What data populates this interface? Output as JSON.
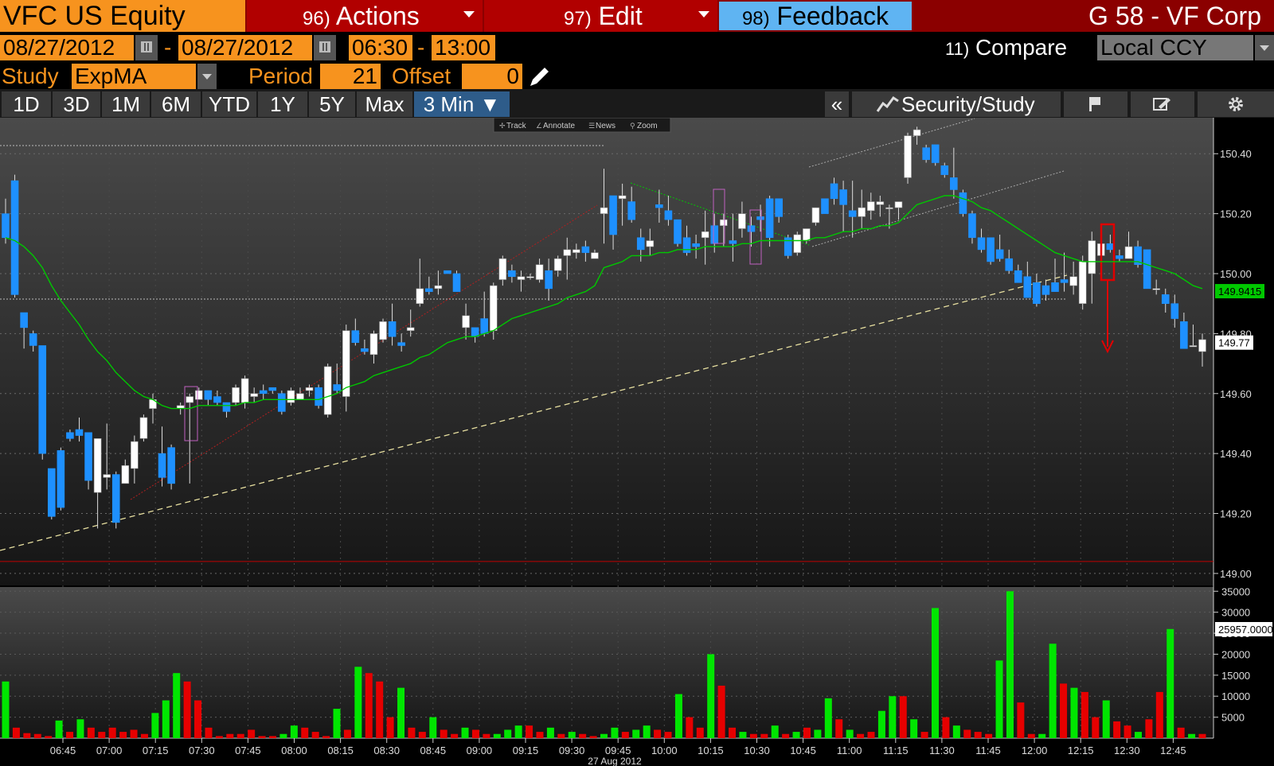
{
  "header": {
    "ticker": "VFC US Equity",
    "actions_num": "96)",
    "actions": "Actions",
    "edit_num": "97)",
    "edit": "Edit",
    "feedback_num": "98)",
    "feedback": "Feedback",
    "title": "G 58 - VF Corp"
  },
  "controls": {
    "start_date": "08/27/2012",
    "dash": "-",
    "end_date": "08/27/2012",
    "start_time": "06:30",
    "end_time": "13:00",
    "compare_num": "11)",
    "compare": "Compare",
    "currency": "Local CCY",
    "study_label": "Study",
    "study": "ExpMA",
    "period_label": "Period",
    "period": "21",
    "offset_label": "Offset",
    "offset": "0"
  },
  "tabs": [
    "1D",
    "3D",
    "1M",
    "6M",
    "YTD",
    "1Y",
    "5Y",
    "Max",
    "3 Min ▼"
  ],
  "right_tabs": {
    "collapse": "«",
    "security_study": "Security/Study"
  },
  "toolbar": [
    "Track",
    "Annotate",
    "News",
    "Zoom"
  ],
  "colors": {
    "up_volume": "#00e600",
    "down_volume": "#e60000",
    "candle_down": "#1e90ff",
    "ema": "#00c800",
    "orange": "#f7931e"
  },
  "chart_data": {
    "type": "candlestick",
    "date_label": "27 Aug 2012",
    "time_labels": [
      "06:45",
      "07:00",
      "07:15",
      "07:30",
      "07:45",
      "08:00",
      "08:15",
      "08:30",
      "08:45",
      "09:00",
      "09:15",
      "09:30",
      "09:45",
      "10:00",
      "10:15",
      "10:30",
      "10:45",
      "11:00",
      "11:15",
      "11:30",
      "11:45",
      "12:00",
      "12:15",
      "12:30",
      "12:45"
    ],
    "price_ticks": [
      "150.40",
      "150.20",
      "150.00",
      "149.80",
      "149.60",
      "149.40",
      "149.20",
      "149.00"
    ],
    "price_ylim": [
      148.96,
      150.52
    ],
    "volume_ticks": [
      "35000",
      "30000",
      "25000",
      "20000",
      "15000",
      "10000",
      "5000"
    ],
    "volume_ylim": [
      0,
      36000
    ],
    "last_price": "149.77",
    "ema_last": "149.9415",
    "last_volume": "25957.0000",
    "candles_ohlc": [
      [
        150.2,
        150.25,
        150.1,
        150.12
      ],
      [
        150.31,
        150.33,
        149.92,
        149.93
      ],
      [
        149.87,
        149.87,
        149.75,
        149.82
      ],
      [
        149.8,
        149.81,
        149.74,
        149.76
      ],
      [
        149.76,
        149.76,
        149.38,
        149.4
      ],
      [
        149.35,
        149.35,
        149.18,
        149.19
      ],
      [
        149.41,
        149.42,
        149.21,
        149.22
      ],
      [
        149.47,
        149.48,
        149.44,
        149.45
      ],
      [
        149.48,
        149.52,
        149.44,
        149.46
      ],
      [
        149.47,
        149.47,
        149.28,
        149.31
      ],
      [
        149.27,
        149.37,
        149.15,
        149.45
      ],
      [
        149.32,
        149.5,
        149.28,
        149.33
      ],
      [
        149.33,
        149.34,
        149.15,
        149.17
      ],
      [
        149.3,
        149.38,
        149.3,
        149.36
      ],
      [
        149.35,
        149.46,
        149.3,
        149.44
      ],
      [
        149.45,
        149.53,
        149.44,
        149.52
      ],
      [
        149.55,
        149.6,
        149.5,
        149.58
      ],
      [
        149.4,
        149.49,
        149.29,
        149.32
      ],
      [
        149.42,
        149.43,
        149.28,
        149.3
      ],
      [
        149.55,
        149.57,
        149.53,
        149.56
      ],
      [
        149.57,
        149.6,
        149.3,
        149.59
      ],
      [
        149.58,
        149.62,
        149.59,
        149.61
      ],
      [
        149.61,
        149.61,
        149.56,
        149.58
      ],
      [
        149.59,
        149.61,
        149.56,
        149.57
      ],
      [
        149.57,
        149.57,
        149.52,
        149.54
      ],
      [
        149.57,
        149.63,
        149.56,
        149.62
      ],
      [
        149.57,
        149.66,
        149.55,
        149.65
      ],
      [
        149.59,
        149.62,
        149.57,
        149.6
      ],
      [
        149.61,
        149.63,
        149.58,
        149.6
      ],
      [
        149.62,
        149.62,
        149.6,
        149.61
      ],
      [
        149.6,
        149.61,
        149.53,
        149.54
      ],
      [
        149.57,
        149.62,
        149.56,
        149.61
      ],
      [
        149.58,
        149.62,
        149.58,
        149.6
      ],
      [
        149.61,
        149.63,
        149.59,
        149.62
      ],
      [
        149.62,
        149.63,
        149.55,
        149.56
      ],
      [
        149.53,
        149.7,
        149.52,
        149.69
      ],
      [
        149.63,
        149.7,
        149.6,
        149.61
      ],
      [
        149.59,
        149.83,
        149.54,
        149.81
      ],
      [
        149.81,
        149.85,
        149.76,
        149.77
      ],
      [
        149.75,
        149.78,
        149.73,
        149.74
      ],
      [
        149.73,
        149.81,
        149.7,
        149.8
      ],
      [
        149.78,
        149.85,
        149.77,
        149.84
      ],
      [
        149.84,
        149.9,
        149.76,
        149.79
      ],
      [
        149.77,
        149.8,
        149.74,
        149.76
      ],
      [
        149.81,
        149.88,
        149.79,
        149.82
      ],
      [
        149.9,
        150.05,
        149.89,
        149.95
      ],
      [
        149.95,
        149.99,
        149.93,
        149.94
      ],
      [
        149.95,
        150.01,
        149.93,
        149.96
      ],
      [
        150.01,
        150.01,
        150.0,
        150.0
      ],
      [
        150.0,
        150.01,
        149.95,
        149.94
      ],
      [
        149.82,
        149.9,
        149.78,
        149.86
      ],
      [
        149.82,
        149.81,
        149.77,
        149.79
      ],
      [
        149.85,
        149.94,
        149.79,
        149.8
      ],
      [
        149.81,
        149.97,
        149.78,
        149.96
      ],
      [
        149.98,
        150.06,
        149.96,
        150.05
      ],
      [
        150.01,
        150.03,
        149.97,
        149.99
      ],
      [
        149.98,
        150.01,
        149.94,
        149.99
      ],
      [
        149.99,
        150.0,
        149.98,
        149.99
      ],
      [
        149.98,
        150.05,
        149.97,
        150.03
      ],
      [
        150.01,
        150.05,
        149.91,
        149.95
      ],
      [
        150.01,
        150.06,
        149.99,
        150.05
      ],
      [
        150.06,
        150.12,
        149.98,
        150.08
      ],
      [
        150.07,
        150.1,
        150.05,
        150.08
      ],
      [
        150.09,
        150.11,
        150.04,
        150.07
      ],
      [
        150.05,
        150.08,
        150.06,
        150.07
      ],
      [
        150.2,
        150.35,
        150.1,
        150.22
      ],
      [
        150.26,
        150.26,
        150.08,
        150.13
      ],
      [
        150.25,
        150.3,
        150.16,
        150.26
      ],
      [
        150.24,
        150.29,
        150.17,
        150.18
      ],
      [
        150.12,
        150.15,
        150.04,
        150.08
      ],
      [
        150.09,
        150.15,
        150.06,
        150.11
      ],
      [
        150.23,
        150.28,
        150.17,
        150.22
      ],
      [
        150.21,
        150.26,
        150.16,
        150.18
      ],
      [
        150.18,
        150.16,
        150.09,
        150.1
      ],
      [
        150.12,
        150.16,
        150.06,
        150.07
      ],
      [
        150.1,
        150.13,
        150.05,
        150.09
      ],
      [
        150.12,
        150.21,
        150.03,
        150.14
      ],
      [
        150.16,
        150.2,
        150.07,
        150.1
      ],
      [
        150.16,
        150.2,
        150.09,
        150.18
      ],
      [
        150.11,
        150.2,
        150.04,
        150.1
      ],
      [
        150.15,
        150.24,
        150.12,
        150.2
      ],
      [
        150.16,
        150.19,
        150.09,
        150.14
      ],
      [
        150.19,
        150.23,
        150.14,
        150.18
      ],
      [
        150.25,
        150.26,
        150.09,
        150.12
      ],
      [
        150.25,
        150.25,
        150.17,
        150.19
      ],
      [
        150.12,
        150.13,
        150.05,
        150.06
      ],
      [
        150.07,
        150.14,
        150.06,
        150.13
      ],
      [
        150.11,
        150.13,
        150.1,
        150.15
      ],
      [
        150.17,
        150.22,
        150.16,
        150.22
      ],
      [
        150.25,
        150.25,
        150.2,
        150.2
      ],
      [
        150.3,
        150.32,
        150.23,
        150.25
      ],
      [
        150.28,
        150.31,
        150.14,
        150.23
      ],
      [
        150.21,
        150.31,
        150.12,
        150.19
      ],
      [
        150.19,
        150.28,
        150.15,
        150.22
      ],
      [
        150.21,
        150.27,
        150.18,
        150.24
      ],
      [
        150.23,
        150.26,
        150.19,
        150.24
      ],
      [
        150.22,
        150.23,
        150.15,
        150.22
      ],
      [
        150.22,
        150.24,
        150.18,
        150.24
      ],
      [
        150.32,
        150.47,
        150.3,
        150.46
      ],
      [
        150.46,
        150.49,
        150.43,
        150.48
      ],
      [
        150.42,
        150.43,
        150.37,
        150.38
      ],
      [
        150.43,
        150.43,
        150.36,
        150.37
      ],
      [
        150.36,
        150.37,
        150.32,
        150.33
      ],
      [
        150.32,
        150.42,
        150.25,
        150.28
      ],
      [
        150.27,
        150.28,
        150.19,
        150.2
      ],
      [
        150.2,
        150.21,
        150.1,
        150.12
      ],
      [
        150.12,
        150.15,
        150.07,
        150.08
      ],
      [
        150.12,
        150.12,
        150.03,
        150.04
      ],
      [
        150.08,
        150.13,
        150.04,
        150.05
      ],
      [
        150.05,
        150.08,
        150.0,
        150.01
      ],
      [
        150.01,
        150.03,
        149.99,
        149.97
      ],
      [
        149.99,
        150.04,
        149.92,
        149.92
      ],
      [
        149.97,
        150.0,
        149.89,
        149.9
      ],
      [
        149.96,
        149.98,
        149.91,
        149.93
      ],
      [
        149.97,
        150.05,
        149.94,
        149.94
      ],
      [
        149.98,
        150.07,
        149.94,
        149.97
      ],
      [
        149.96,
        150.04,
        149.93,
        149.99
      ],
      [
        149.9,
        150.06,
        149.88,
        150.04
      ],
      [
        150.0,
        150.14,
        149.9,
        150.11
      ],
      [
        150.06,
        150.1,
        150.04,
        150.1
      ],
      [
        150.1,
        150.13,
        150.07,
        150.08
      ],
      [
        150.06,
        150.08,
        150.04,
        150.05
      ],
      [
        150.05,
        150.14,
        150.06,
        150.09
      ],
      [
        150.09,
        150.11,
        150.02,
        150.03
      ],
      [
        150.08,
        150.08,
        149.98,
        149.95
      ],
      [
        149.95,
        149.98,
        149.93,
        149.95
      ],
      [
        149.93,
        149.95,
        149.87,
        149.9
      ],
      [
        149.9,
        149.93,
        149.82,
        149.85
      ],
      [
        149.84,
        149.87,
        149.76,
        149.75
      ],
      [
        149.76,
        149.83,
        149.76,
        149.76
      ],
      [
        149.74,
        149.8,
        149.69,
        149.78
      ]
    ],
    "ema": [
      150.12,
      150.11,
      150.09,
      150.06,
      150.02,
      149.96,
      149.91,
      149.87,
      149.83,
      149.78,
      149.74,
      149.71,
      149.67,
      149.64,
      149.61,
      149.59,
      149.58,
      149.56,
      149.55,
      149.55,
      149.55,
      149.56,
      149.56,
      149.56,
      149.56,
      149.56,
      149.57,
      149.57,
      149.58,
      149.58,
      149.58,
      149.58,
      149.58,
      149.58,
      149.58,
      149.59,
      149.6,
      149.62,
      149.63,
      149.64,
      149.66,
      149.67,
      149.68,
      149.69,
      149.7,
      149.72,
      149.73,
      149.75,
      149.77,
      149.78,
      149.79,
      149.79,
      149.8,
      149.81,
      149.83,
      149.85,
      149.86,
      149.87,
      149.88,
      149.89,
      149.9,
      149.92,
      149.93,
      149.94,
      149.96,
      150.02,
      150.03,
      150.04,
      150.06,
      150.06,
      150.06,
      150.07,
      150.07,
      150.08,
      150.08,
      150.08,
      150.09,
      150.09,
      150.09,
      150.09,
      150.1,
      150.1,
      150.11,
      150.11,
      150.11,
      150.11,
      150.11,
      150.11,
      150.12,
      150.12,
      150.13,
      150.14,
      150.14,
      150.15,
      150.15,
      150.16,
      150.16,
      150.17,
      150.2,
      150.23,
      150.24,
      150.25,
      150.26,
      150.26,
      150.25,
      150.24,
      150.22,
      150.21,
      150.19,
      150.17,
      150.15,
      150.13,
      150.11,
      150.09,
      150.07,
      150.06,
      150.05,
      150.04,
      150.04,
      150.04,
      150.04,
      150.04,
      150.04,
      150.04,
      150.03,
      150.02,
      150.01,
      150.0,
      149.98,
      149.96,
      149.95
    ]
  }
}
